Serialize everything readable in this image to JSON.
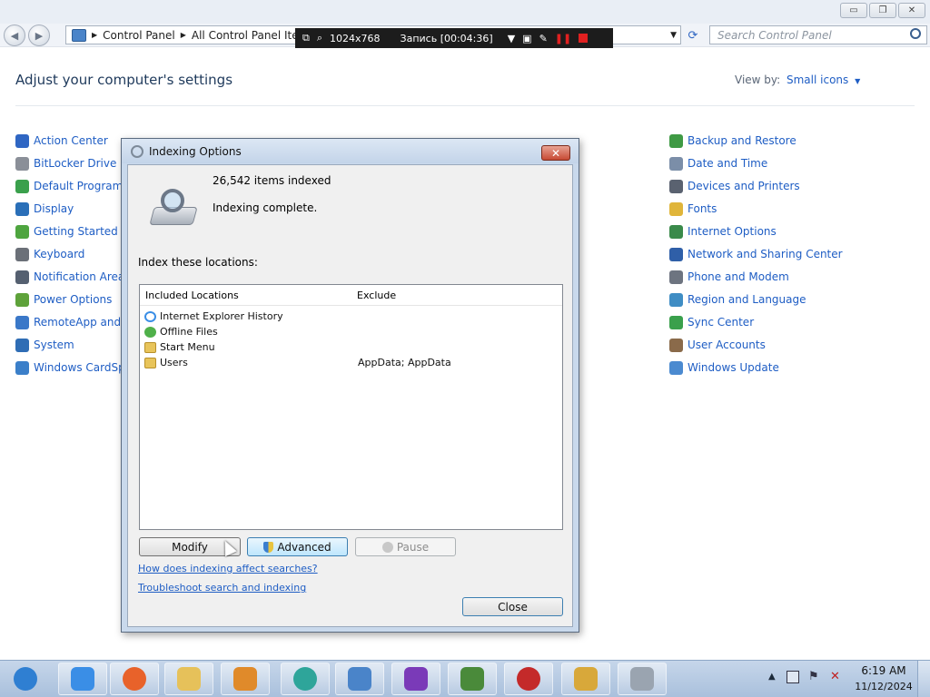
{
  "window": {
    "minimize": "▭",
    "maximize": "❐",
    "close": "✕"
  },
  "address": {
    "back": "◀",
    "forward": "▶",
    "crumbs": [
      "Control Panel",
      "All Control Panel Items"
    ],
    "refresh": "⟳",
    "search_placeholder": "Search Control Panel"
  },
  "recorder": {
    "resolution": "1024x768",
    "status": "Запись [00:04:36]"
  },
  "main": {
    "heading": "Adjust your computer's settings",
    "view_by_label": "View by:",
    "view_by_value": "Small icons"
  },
  "cp_left": [
    {
      "label": "Action Center",
      "icon": "flag-icon",
      "color": "#2f66c3"
    },
    {
      "label": "BitLocker Drive En",
      "icon": "bitlocker-icon",
      "color": "#8a8f98"
    },
    {
      "label": "Default Programs",
      "icon": "default-programs-icon",
      "color": "#3aa04c"
    },
    {
      "label": "Display",
      "icon": "display-icon",
      "color": "#2a6fb8"
    },
    {
      "label": "Getting Started",
      "icon": "getting-started-icon",
      "color": "#4ea53f"
    },
    {
      "label": "Keyboard",
      "icon": "keyboard-icon",
      "color": "#6b7078"
    },
    {
      "label": "Notification Area I",
      "icon": "notification-icon",
      "color": "#556070"
    },
    {
      "label": "Power Options",
      "icon": "power-icon",
      "color": "#5ea23a"
    },
    {
      "label": "RemoteApp and D",
      "icon": "remoteapp-icon",
      "color": "#3a78c8"
    },
    {
      "label": "System",
      "icon": "system-icon",
      "color": "#2f6db5"
    },
    {
      "label": "Windows CardSpa",
      "icon": "cardspace-icon",
      "color": "#3b7fc9"
    }
  ],
  "cp_right": [
    {
      "label": "Backup and Restore",
      "icon": "backup-icon",
      "color": "#3f9a44"
    },
    {
      "label": "Date and Time",
      "icon": "datetime-icon",
      "color": "#7b8ea8"
    },
    {
      "label": "Devices and Printers",
      "icon": "printer-icon",
      "color": "#5a6270"
    },
    {
      "label": "Fonts",
      "icon": "fonts-icon",
      "color": "#e0b53a"
    },
    {
      "label": "Internet Options",
      "icon": "internet-options-icon",
      "color": "#3a8a4a"
    },
    {
      "label": "Network and Sharing Center",
      "icon": "network-icon",
      "color": "#2f5fa8"
    },
    {
      "label": "Phone and Modem",
      "icon": "phone-icon",
      "color": "#6d7480"
    },
    {
      "label": "Region and Language",
      "icon": "region-icon",
      "color": "#3f8dc4"
    },
    {
      "label": "Sync Center",
      "icon": "sync-icon",
      "color": "#3aa04c"
    },
    {
      "label": "User Accounts",
      "icon": "users-icon",
      "color": "#8a6a4a"
    },
    {
      "label": "Windows Update",
      "icon": "windows-update-icon",
      "color": "#4b8ad0"
    }
  ],
  "dialog": {
    "title": "Indexing Options",
    "items_indexed": "26,542 items indexed",
    "status": "Indexing complete.",
    "index_label": "Index these locations:",
    "col_included": "Included Locations",
    "col_exclude": "Exclude",
    "locations": [
      {
        "name": "Internet Explorer History",
        "exclude": "",
        "icon": "ie-icon"
      },
      {
        "name": "Offline Files",
        "exclude": "",
        "icon": "offline-files-icon"
      },
      {
        "name": "Start Menu",
        "exclude": "",
        "icon": "folder-icon"
      },
      {
        "name": "Users",
        "exclude": "AppData; AppData",
        "icon": "folder-icon"
      }
    ],
    "modify": "Modify",
    "advanced": "Advanced",
    "pause": "Pause",
    "link_affect": "How does indexing affect searches?",
    "link_troubleshoot": "Troubleshoot search and indexing",
    "close": "Close"
  },
  "taskbar": {
    "time": "6:19 AM",
    "date": "11/12/2024",
    "apps": [
      {
        "name": "start-orb",
        "color": "#2f7fd2"
      },
      {
        "name": "internet-explorer-icon",
        "color": "#3a8ee6"
      },
      {
        "name": "firefox-icon",
        "color": "#e8622a"
      },
      {
        "name": "explorer-icon",
        "color": "#e6c15a"
      },
      {
        "name": "media-player-icon",
        "color": "#e08a2a"
      },
      {
        "name": "app-circle-icon",
        "color": "#2ea59a"
      },
      {
        "name": "control-panel-icon",
        "color": "#4a84c9"
      },
      {
        "name": "mask-app-icon",
        "color": "#7a3ab8"
      },
      {
        "name": "monitor-app-icon",
        "color": "#4a8a3a"
      },
      {
        "name": "recorder-icon",
        "color": "#c42a2a"
      },
      {
        "name": "ruler-tool-icon",
        "color": "#d8a83a"
      },
      {
        "name": "indexing-icon",
        "color": "#9aa4b0"
      }
    ]
  }
}
